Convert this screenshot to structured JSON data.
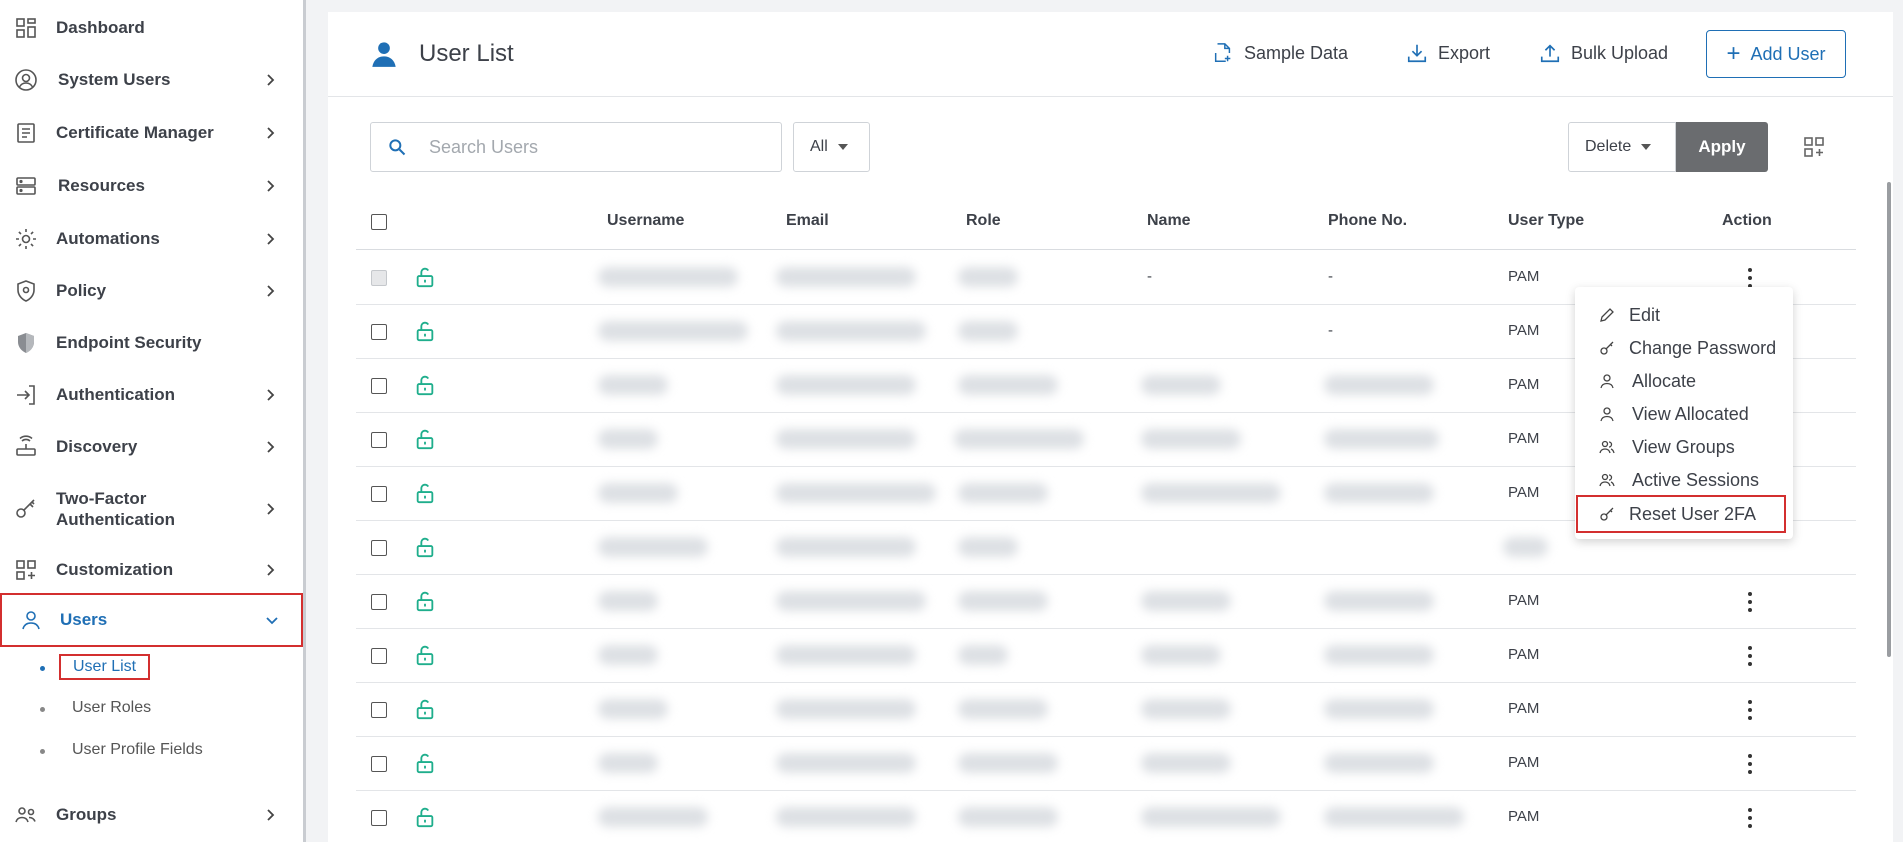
{
  "sidebar": {
    "items": [
      {
        "label": "Dashboard",
        "icon": "dashboard-icon"
      },
      {
        "label": "System Users",
        "icon": "user-circle-icon"
      },
      {
        "label": "Certificate Manager",
        "icon": "certificate-icon"
      },
      {
        "label": "Resources",
        "icon": "server-icon"
      },
      {
        "label": "Automations",
        "icon": "gear-icon"
      },
      {
        "label": "Policy",
        "icon": "shield-icon"
      },
      {
        "label": "Endpoint Security",
        "icon": "shield-filled-icon"
      },
      {
        "label": "Authentication",
        "icon": "login-icon"
      },
      {
        "label": "Discovery",
        "icon": "router-icon"
      },
      {
        "label": "Two-Factor",
        "label2": "Authentication",
        "icon": "key-icon"
      },
      {
        "label": "Customization",
        "icon": "grid-plus-icon"
      },
      {
        "label": "Users",
        "icon": "user-icon"
      },
      {
        "label": "Groups",
        "icon": "group-icon"
      }
    ],
    "sub_items": [
      "User List",
      "User Roles",
      "User Profile Fields"
    ]
  },
  "header": {
    "title": "User List",
    "sample_data": "Sample Data",
    "export": "Export",
    "bulk_upload": "Bulk Upload",
    "add_user": "Add User"
  },
  "toolbar": {
    "search_placeholder": "Search Users",
    "filter_value": "All",
    "bulk_action": "Delete",
    "apply": "Apply"
  },
  "table": {
    "columns": [
      "Username",
      "Email",
      "Role",
      "Name",
      "Phone No.",
      "User Type",
      "Action"
    ],
    "rows": [
      {
        "name": "-",
        "phone": "-",
        "type": "PAM"
      },
      {
        "name": "",
        "phone": "-",
        "type": "PAM"
      },
      {
        "name": "",
        "phone": "",
        "type": "PAM"
      },
      {
        "name": "",
        "phone": "",
        "type": "PAM"
      },
      {
        "name": "",
        "phone": "",
        "type": "PAM"
      },
      {
        "name": "",
        "phone": "",
        "type": ""
      },
      {
        "name": "",
        "phone": "",
        "type": "PAM"
      },
      {
        "name": "",
        "phone": "",
        "type": "PAM"
      },
      {
        "name": "",
        "phone": "",
        "type": "PAM"
      },
      {
        "name": "",
        "phone": "",
        "type": "PAM"
      },
      {
        "name": "",
        "phone": "",
        "type": "PAM"
      }
    ]
  },
  "action_menu": {
    "items": [
      "Edit",
      "Change Password",
      "Allocate",
      "View Allocated",
      "View Groups",
      "Active Sessions",
      "Reset User 2FA"
    ]
  },
  "colors": {
    "accent": "#1f6fb5",
    "highlight": "#d32f2f",
    "lock": "#1fae8c"
  }
}
